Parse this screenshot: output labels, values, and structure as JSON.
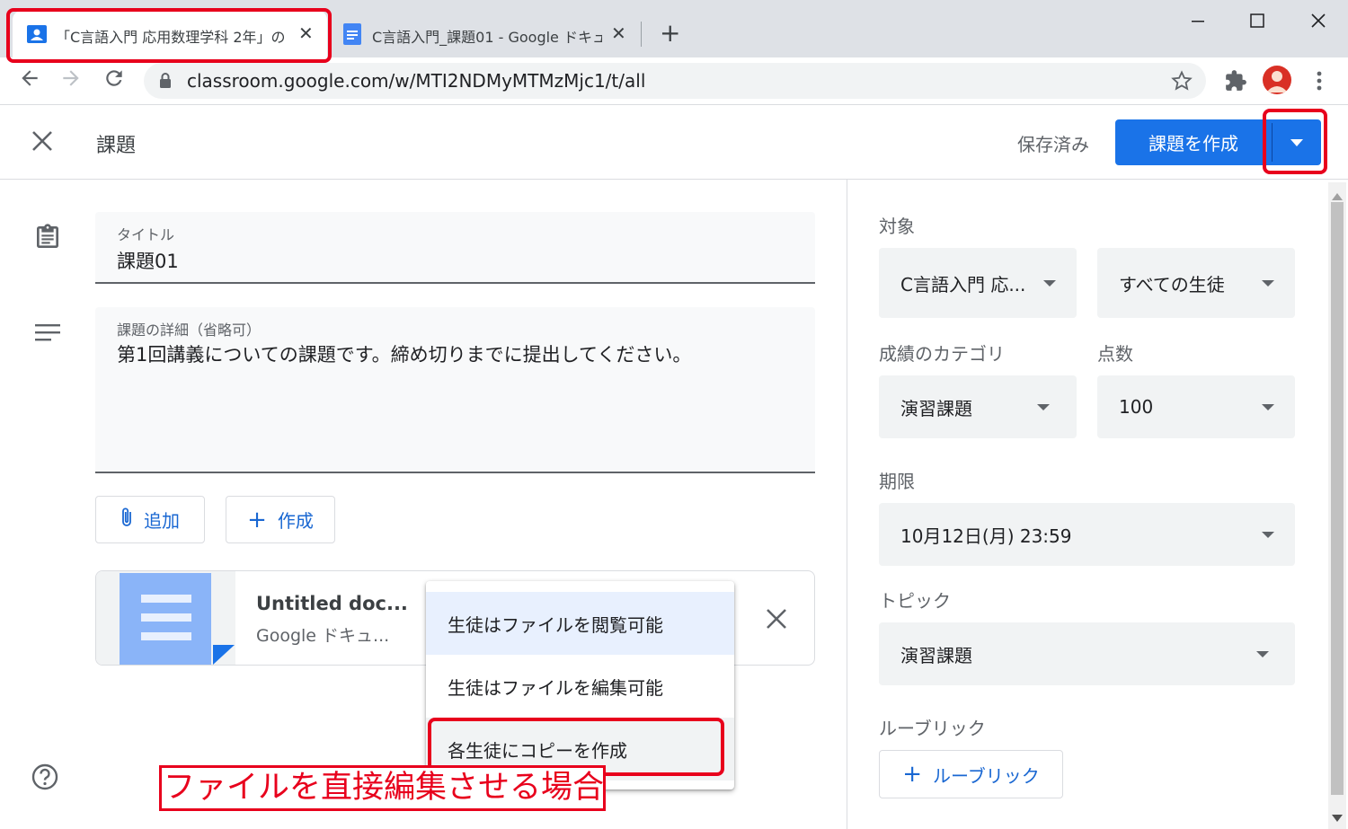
{
  "browser": {
    "tabs": [
      {
        "title": "「C言語入門 応用数理学科 2年」の",
        "active": true
      },
      {
        "title": "C言語入門_課題01 - Google ドキュ",
        "active": false
      }
    ],
    "new_tab": "+",
    "url": "classroom.google.com/w/MTI2NDMyMTMzMjc1/t/all"
  },
  "header": {
    "close": "✕",
    "title": "課題",
    "saved": "保存済み",
    "create_button": "課題を作成"
  },
  "form": {
    "title_label": "タイトル",
    "title_value": "課題01",
    "details_label": "課題の詳細（省略可）",
    "details_value": "第1回講義についての課題です。締め切りまでに提出してください。",
    "add_button": "追加",
    "create_button": "作成"
  },
  "attachment": {
    "name": "Untitled doc...",
    "type": "Google ドキュ..."
  },
  "menu": {
    "items": [
      "生徒はファイルを閲覧可能",
      "生徒はファイルを編集可能",
      "各生徒にコピーを作成"
    ]
  },
  "side": {
    "for_label": "対象",
    "class_value": "C言語入門 応...",
    "students_value": "すべての生徒",
    "category_label": "成績のカテゴリ",
    "category_value": "演習課題",
    "points_label": "点数",
    "points_value": "100",
    "due_label": "期限",
    "due_value": "10月12日(月) 23:59",
    "topic_label": "トピック",
    "topic_value": "演習課題",
    "rubric_label": "ルーブリック",
    "rubric_button": "ルーブリック"
  },
  "annotation": {
    "caption": "ファイルを直接編集させる場合"
  },
  "colors": {
    "accent": "#1a73e8",
    "highlight": "#e8001c"
  }
}
